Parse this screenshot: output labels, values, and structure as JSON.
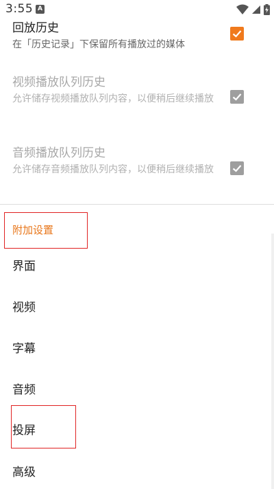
{
  "status_bar": {
    "time": "3:55",
    "app_icon_letter": "A"
  },
  "preferences": [
    {
      "title": "回放历史",
      "summary": "在「历史记录」下保留所有播放过的媒体",
      "enabled": true,
      "checked": true
    },
    {
      "title": "视频播放队列历史",
      "summary": "允许储存视频播放队列内容，以便稍后继续播放",
      "enabled": false,
      "checked": true
    },
    {
      "title": "音频播放队列历史",
      "summary": "允许储存音频播放队列内容，以便稍后继续播放",
      "enabled": false,
      "checked": true
    }
  ],
  "category": {
    "title": "附加设置"
  },
  "nav_items": [
    {
      "label": "界面"
    },
    {
      "label": "视频"
    },
    {
      "label": "字幕"
    },
    {
      "label": "音频"
    },
    {
      "label": "投屏"
    },
    {
      "label": "高级"
    }
  ],
  "colors": {
    "accent": "#f07a1d",
    "category_text": "#e8761a",
    "highlight_border": "#e02020",
    "disabled_checkbox": "#9e9e9e"
  }
}
